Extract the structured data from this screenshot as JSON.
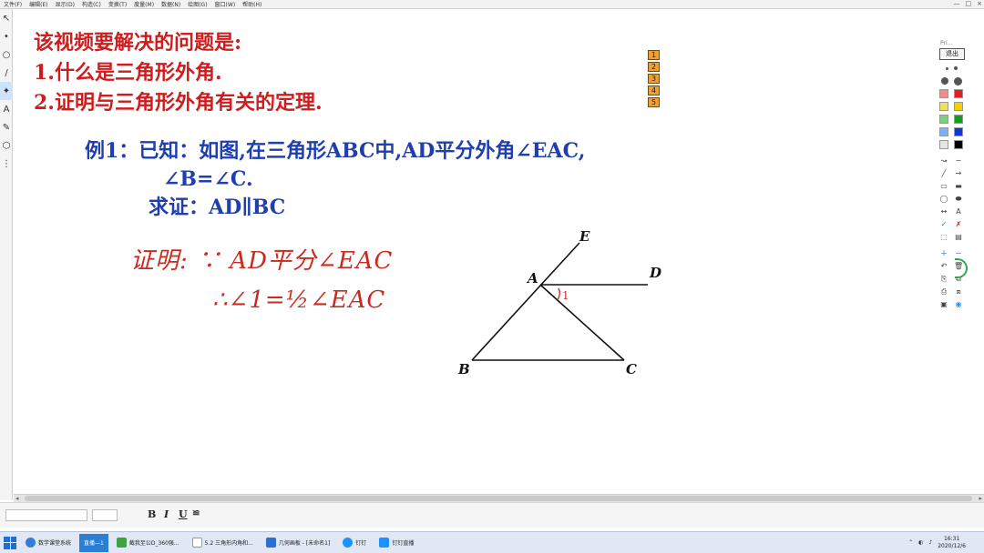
{
  "menu": [
    "文件(F)",
    "编辑(E)",
    "显示(D)",
    "构造(C)",
    "变换(T)",
    "度量(M)",
    "数据(N)",
    "绘图(G)",
    "窗口(W)",
    "帮助(H)"
  ],
  "window_controls": [
    "—",
    "□",
    "×"
  ],
  "left_tools": [
    "↖",
    "•",
    "○",
    "/",
    "✦",
    "A",
    "✎",
    "⬡",
    "⋮"
  ],
  "problems": {
    "heading": "该视频要解决的问题是:",
    "item1": "1.什么是三角形外角.",
    "item2": "2.证明与三角形外角有关的定理."
  },
  "example": {
    "line1": "例1：已知：如图,在三角形ABC中,AD平分外角∠EAC,",
    "line2": "∠B=∠C.",
    "line3": "求证：AD∥BC"
  },
  "handwriting": {
    "line1": "证明: ∵ AD平分∠EAC",
    "line2": "∴∠1=½∠EAC"
  },
  "step_numbers": [
    "1",
    "2",
    "3",
    "4",
    "5"
  ],
  "figure": {
    "labels": {
      "E": "E",
      "A": "A",
      "D": "D",
      "B": "B",
      "C": "C",
      "angle": "1"
    }
  },
  "right_panel": {
    "title": "Pri...",
    "exit_label": "退出",
    "colors": [
      "#f28b8b",
      "#e02020",
      "#f0e060",
      "#f0d000",
      "#7cd07c",
      "#10a020",
      "#7fb0ff",
      "#1038d0",
      "#e6e6e6",
      "#000000"
    ],
    "tool_icons": [
      "↝",
      "∼",
      "╱",
      "→",
      "▭",
      "▬",
      "◯",
      "⬬",
      "↔",
      "A",
      "✓",
      "✗",
      "⬚",
      "▤",
      "＋",
      "－",
      "↶",
      "🗑",
      "⎘",
      "⧉",
      "⎙",
      "⧈",
      "▣",
      "◉"
    ]
  },
  "taskbar": {
    "items": [
      {
        "label": "数学课堂系统",
        "active": false,
        "color": "#3a7bd5"
      },
      {
        "label": "直播—1",
        "active": true,
        "color": "#ffffff"
      },
      {
        "label": "截我至公D_360强...",
        "active": false,
        "color": "#3da33d"
      },
      {
        "label": "5.2 三角形内角和...",
        "active": false,
        "color": "#ffffff"
      },
      {
        "label": "几何画板 - [未命名1]",
        "active": false,
        "color": "#2d6fcf"
      },
      {
        "label": "钉钉",
        "active": false,
        "color": "#1e90ff"
      },
      {
        "label": "钉钉直播",
        "active": false,
        "color": "#1e90ff"
      }
    ],
    "clock_time": "16:31",
    "clock_date": "2020/12/6"
  }
}
